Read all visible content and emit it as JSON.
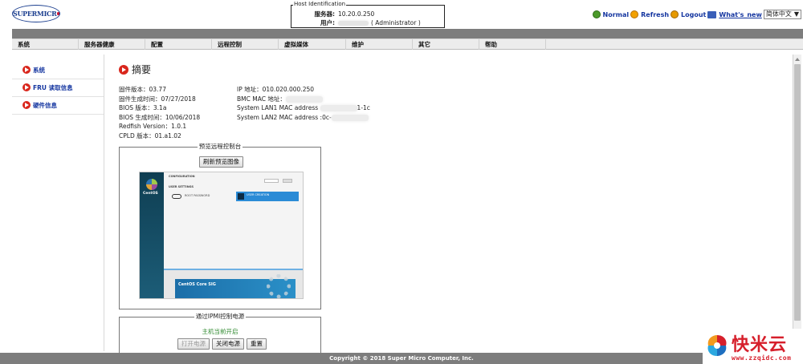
{
  "logo": {
    "text": "SUPERMICR"
  },
  "host": {
    "legend": "Host Identification",
    "server_label": "服务器:",
    "server_value": "10.20.0.250",
    "user_label": "用户:",
    "user_value": "( Administrator )"
  },
  "toplinks": {
    "normal": "Normal",
    "refresh": "Refresh",
    "logout": "Logout",
    "whats_new": "What's_new",
    "language": "简体中文"
  },
  "nav": [
    "系统",
    "服务器健康",
    "配置",
    "远程控制",
    "虚拟媒体",
    "维护",
    "其它",
    "帮助"
  ],
  "sidebar": [
    {
      "label": "系统"
    },
    {
      "label": "FRU 读取信息"
    },
    {
      "label": "硬件信息"
    }
  ],
  "page_title": "摘要",
  "info_left": [
    "固件版本：03.77",
    "固件生成时间：07/27/2018",
    "BIOS 版本：3.1a",
    "BIOS 生成时间：10/06/2018",
    "Redfish Version：1.0.1",
    "CPLD 版本：01.a1.02"
  ],
  "info_right": {
    "ip": "IP 地址：010.020.000.250",
    "bmc_mac": "BMC MAC 地址：",
    "lan1": "System LAN1 MAC address",
    "lan1_tail": "1-1c",
    "lan2": "System LAN2 MAC address :0c-"
  },
  "preview_panel": {
    "title": "预览远程控制台",
    "refresh_button": "刷新预览图像",
    "screen": {
      "os_label": "CentOS",
      "header": "CONFIGURATION",
      "section": "USER SETTINGS",
      "root_password": "ROOT PASSWORD",
      "user_creation": "USER CREATION",
      "banner": "CentOS Core SIG"
    }
  },
  "ipmi_panel": {
    "title": "通过IPMI控制电源",
    "status": "主机当前开启",
    "power_on": "打开电源",
    "power_off": "关闭电源",
    "reset": "重置"
  },
  "footer": {
    "copyright": "Copyright © 2018 Super Micro Computer, Inc."
  },
  "watermark": {
    "brand": "快米云",
    "url": "www.zzqidc.com"
  },
  "colors": {
    "link_blue": "#1536a0",
    "accent_red": "#d9261c",
    "band_gray": "#7d7d7d",
    "status_green": "#2f8a2f"
  }
}
